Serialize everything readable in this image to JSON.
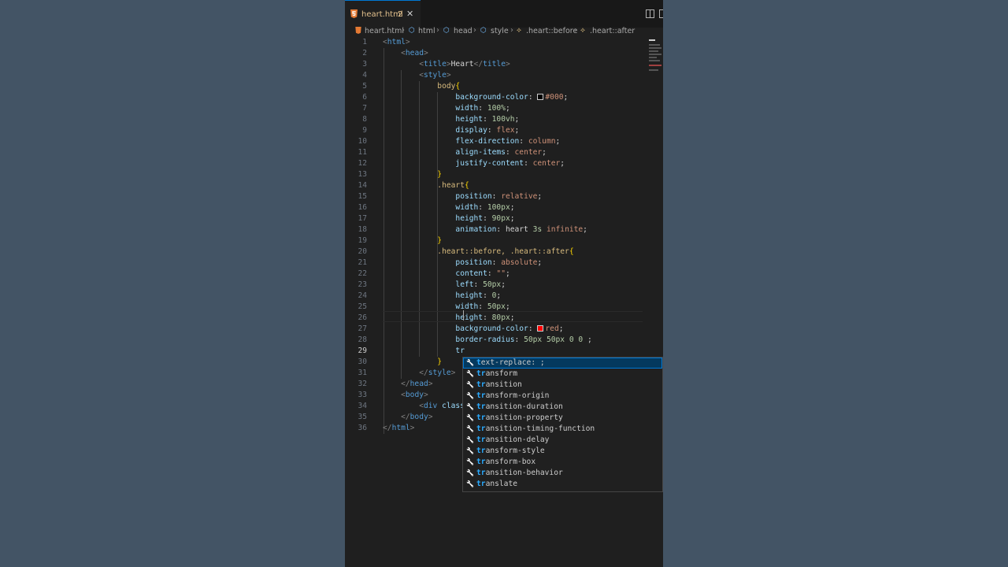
{
  "tab": {
    "filename": "heart.html",
    "problems": "2",
    "close_glyph": "✕"
  },
  "breadcrumb": [
    "heart.html",
    "html",
    "head",
    "style",
    ".heart::before",
    ".heart::after"
  ],
  "current_line": 29,
  "code_lines": [
    [
      [
        "t",
        "<"
      ],
      [
        "tn",
        "html"
      ],
      [
        "t",
        ">"
      ]
    ],
    [
      [
        "t",
        "    <"
      ],
      [
        "tn",
        "head"
      ],
      [
        "t",
        ">"
      ]
    ],
    [
      [
        "t",
        "        <"
      ],
      [
        "tn",
        "title"
      ],
      [
        "t",
        ">"
      ],
      [
        "w",
        "Heart"
      ],
      [
        "t",
        "</"
      ],
      [
        "tn",
        "title"
      ],
      [
        "t",
        ">"
      ]
    ],
    [
      [
        "t",
        "        <"
      ],
      [
        "tn",
        "style"
      ],
      [
        "t",
        ">"
      ]
    ],
    [
      [
        "s",
        "            body"
      ],
      [
        "b",
        "{"
      ]
    ],
    [
      [
        "p",
        "                background-color"
      ],
      [
        "w",
        ": "
      ],
      [
        "sw",
        "#000000"
      ],
      [
        "v",
        "#000"
      ],
      [
        "w",
        ";"
      ]
    ],
    [
      [
        "p",
        "                width"
      ],
      [
        "w",
        ": "
      ],
      [
        "n",
        "100%"
      ],
      [
        "w",
        ";"
      ]
    ],
    [
      [
        "p",
        "                height"
      ],
      [
        "w",
        ": "
      ],
      [
        "n",
        "100vh"
      ],
      [
        "w",
        ";"
      ]
    ],
    [
      [
        "p",
        "                display"
      ],
      [
        "w",
        ": "
      ],
      [
        "v",
        "flex"
      ],
      [
        "w",
        ";"
      ]
    ],
    [
      [
        "p",
        "                flex-direction"
      ],
      [
        "w",
        ": "
      ],
      [
        "v",
        "column"
      ],
      [
        "w",
        ";"
      ]
    ],
    [
      [
        "p",
        "                align-items"
      ],
      [
        "w",
        ": "
      ],
      [
        "v",
        "center"
      ],
      [
        "w",
        ";"
      ]
    ],
    [
      [
        "p",
        "                justify-content"
      ],
      [
        "w",
        ": "
      ],
      [
        "v",
        "center"
      ],
      [
        "w",
        ";"
      ]
    ],
    [
      [
        "b",
        "            }"
      ]
    ],
    [
      [
        "s",
        "            .heart"
      ],
      [
        "b",
        "{"
      ]
    ],
    [
      [
        "p",
        "                position"
      ],
      [
        "w",
        ": "
      ],
      [
        "v",
        "relative"
      ],
      [
        "w",
        ";"
      ]
    ],
    [
      [
        "p",
        "                width"
      ],
      [
        "w",
        ": "
      ],
      [
        "n",
        "100px"
      ],
      [
        "w",
        ";"
      ]
    ],
    [
      [
        "p",
        "                height"
      ],
      [
        "w",
        ": "
      ],
      [
        "n",
        "90px"
      ],
      [
        "w",
        ";"
      ]
    ],
    [
      [
        "p",
        "                animation"
      ],
      [
        "w",
        ": heart "
      ],
      [
        "n",
        "3s"
      ],
      [
        "v",
        " infinite"
      ],
      [
        "w",
        ";"
      ]
    ],
    [
      [
        "b",
        "            }"
      ]
    ],
    [
      [
        "s",
        "            .heart::before, .heart::after"
      ],
      [
        "b",
        "{"
      ]
    ],
    [
      [
        "p",
        "                position"
      ],
      [
        "w",
        ": "
      ],
      [
        "v",
        "absolute"
      ],
      [
        "w",
        ";"
      ]
    ],
    [
      [
        "p",
        "                content"
      ],
      [
        "w",
        ": "
      ],
      [
        "v",
        "\"\""
      ],
      [
        "w",
        ";"
      ]
    ],
    [
      [
        "p",
        "                left"
      ],
      [
        "w",
        ": "
      ],
      [
        "n",
        "50px"
      ],
      [
        "w",
        ";"
      ]
    ],
    [
      [
        "p",
        "                height"
      ],
      [
        "w",
        ": "
      ],
      [
        "n",
        "0"
      ],
      [
        "w",
        ";"
      ]
    ],
    [
      [
        "p",
        "                width"
      ],
      [
        "w",
        ": "
      ],
      [
        "n",
        "50px"
      ],
      [
        "w",
        ";"
      ]
    ],
    [
      [
        "p",
        "                height"
      ],
      [
        "w",
        ": "
      ],
      [
        "n",
        "80px"
      ],
      [
        "w",
        ";"
      ]
    ],
    [
      [
        "p",
        "                background-color"
      ],
      [
        "w",
        ": "
      ],
      [
        "sw",
        "#ff0000"
      ],
      [
        "v",
        "red"
      ],
      [
        "w",
        ";"
      ]
    ],
    [
      [
        "p",
        "                border-radius"
      ],
      [
        "w",
        ": "
      ],
      [
        "n",
        "50px 50px 0 0"
      ],
      [
        "w",
        " ;"
      ]
    ],
    [
      [
        "p",
        "                tr"
      ]
    ],
    [
      [
        "b",
        "            }"
      ]
    ],
    [
      [
        "t",
        "        </"
      ],
      [
        "tn",
        "style"
      ],
      [
        "t",
        ">"
      ]
    ],
    [
      [
        "t",
        "    </"
      ],
      [
        "tn",
        "head"
      ],
      [
        "t",
        ">"
      ]
    ],
    [
      [
        "t",
        "    <"
      ],
      [
        "tn",
        "body"
      ],
      [
        "t",
        ">"
      ]
    ],
    [
      [
        "t",
        "        <"
      ],
      [
        "tn",
        "div"
      ],
      [
        "p",
        " class"
      ]
    ],
    [
      [
        "t",
        "    </"
      ],
      [
        "tn",
        "body"
      ],
      [
        "t",
        ">"
      ]
    ],
    [
      [
        "t",
        "</"
      ],
      [
        "tn",
        "html"
      ],
      [
        "t",
        ">"
      ]
    ]
  ],
  "suggestions": {
    "typed": "t",
    "items": [
      "text-replace: ;",
      "transform",
      "transition",
      "transform-origin",
      "transition-duration",
      "transition-property",
      "transition-timing-function",
      "transition-delay",
      "transform-style",
      "transform-box",
      "transition-behavior",
      "translate"
    ],
    "highlights": [
      "t",
      "tr",
      "tr",
      "tr",
      "tr",
      "tr",
      "tr",
      "tr",
      "tr",
      "tr",
      "tr",
      "tr"
    ]
  },
  "icons": {
    "suggestion": "wrench-icon",
    "file": "html5-icon"
  },
  "colors": {
    "accent": "#0078d4",
    "selection": "#04395e",
    "editor_bg": "#1f1f1f",
    "outside_bg": "#435465"
  }
}
